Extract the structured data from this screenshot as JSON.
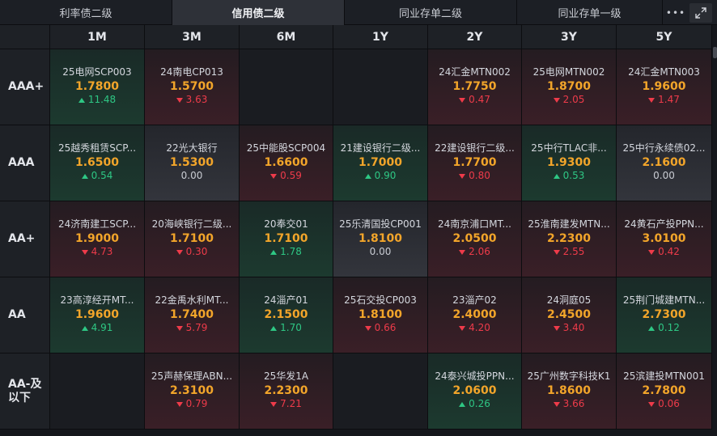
{
  "tabs": [
    {
      "label": "利率债二级",
      "active": false
    },
    {
      "label": "信用债二级",
      "active": true
    },
    {
      "label": "同业存单二级",
      "active": false
    },
    {
      "label": "同业存单一级",
      "active": false
    }
  ],
  "toolbar": {
    "more_label": "•••"
  },
  "columns": [
    "1M",
    "3M",
    "6M",
    "1Y",
    "2Y",
    "3Y",
    "5Y"
  ],
  "rows": [
    {
      "label": "AAA+",
      "cells": [
        {
          "name": "25电网SCP003",
          "price": "1.7800",
          "change": "11.48",
          "dir": "up"
        },
        {
          "name": "24南电CP013",
          "price": "1.5700",
          "change": "3.63",
          "dir": "down"
        },
        null,
        null,
        {
          "name": "24汇金MTN002",
          "price": "1.7750",
          "change": "0.47",
          "dir": "down"
        },
        {
          "name": "25电网MTN002",
          "price": "1.8700",
          "change": "2.05",
          "dir": "down"
        },
        {
          "name": "24汇金MTN003",
          "price": "1.9600",
          "change": "1.47",
          "dir": "down"
        }
      ]
    },
    {
      "label": "AAA",
      "cells": [
        {
          "name": "25越秀租赁SCP...",
          "price": "1.6500",
          "change": "0.54",
          "dir": "up"
        },
        {
          "name": "22光大银行",
          "price": "1.5300",
          "change": "0.00",
          "dir": "flat"
        },
        {
          "name": "25中能股SCP004",
          "price": "1.6600",
          "change": "0.59",
          "dir": "down"
        },
        {
          "name": "21建设银行二级...",
          "price": "1.7000",
          "change": "0.90",
          "dir": "up"
        },
        {
          "name": "22建设银行二级...",
          "price": "1.7700",
          "change": "0.80",
          "dir": "down"
        },
        {
          "name": "25中行TLAC非...",
          "price": "1.9300",
          "change": "0.53",
          "dir": "up"
        },
        {
          "name": "25中行永续债02...",
          "price": "2.1600",
          "change": "0.00",
          "dir": "flat"
        }
      ]
    },
    {
      "label": "AA+",
      "cells": [
        {
          "name": "24济南建工SCP...",
          "price": "1.9000",
          "change": "4.73",
          "dir": "down"
        },
        {
          "name": "20海峡银行二级...",
          "price": "1.7100",
          "change": "0.30",
          "dir": "down"
        },
        {
          "name": "20奉交01",
          "price": "1.7100",
          "change": "1.78",
          "dir": "up"
        },
        {
          "name": "25乐清国投CP001",
          "price": "1.8100",
          "change": "0.00",
          "dir": "flat"
        },
        {
          "name": "24南京浦口MT...",
          "price": "2.0500",
          "change": "2.06",
          "dir": "down"
        },
        {
          "name": "25淮南建发MTN...",
          "price": "2.2300",
          "change": "2.55",
          "dir": "down"
        },
        {
          "name": "24黄石产投PPN...",
          "price": "3.0100",
          "change": "0.42",
          "dir": "down"
        }
      ]
    },
    {
      "label": "AA",
      "cells": [
        {
          "name": "23高淳经开MT...",
          "price": "1.9600",
          "change": "4.91",
          "dir": "up"
        },
        {
          "name": "22金禹水利MT...",
          "price": "1.7400",
          "change": "5.79",
          "dir": "down"
        },
        {
          "name": "24淄产01",
          "price": "2.1500",
          "change": "1.70",
          "dir": "up"
        },
        {
          "name": "25石交投CP003",
          "price": "1.8100",
          "change": "0.66",
          "dir": "down"
        },
        {
          "name": "23淄产02",
          "price": "2.4000",
          "change": "4.20",
          "dir": "down"
        },
        {
          "name": "24洞庭05",
          "price": "2.4500",
          "change": "3.40",
          "dir": "down"
        },
        {
          "name": "25荆门城建MTN...",
          "price": "2.7300",
          "change": "0.12",
          "dir": "up"
        }
      ]
    },
    {
      "label": "AA-及以下",
      "label_lines": [
        "AA-及",
        "以下"
      ],
      "cells": [
        null,
        {
          "name": "25声赫保理ABN...",
          "price": "2.3100",
          "change": "0.79",
          "dir": "down"
        },
        {
          "name": "25华发1A",
          "price": "2.2300",
          "change": "7.21",
          "dir": "down"
        },
        null,
        {
          "name": "24泰兴城投PPN...",
          "price": "2.0600",
          "change": "0.26",
          "dir": "up"
        },
        {
          "name": "25广州数字科技K1",
          "price": "1.8600",
          "change": "3.66",
          "dir": "down"
        },
        {
          "name": "25滨建投MTN001",
          "price": "2.7800",
          "change": "0.06",
          "dir": "down"
        }
      ]
    }
  ],
  "colors": {
    "up": "#2ec784",
    "down": "#ee3b4a",
    "price": "#f2a52a"
  },
  "icons": {
    "more": "more-dots-icon",
    "expand": "expand-icon",
    "up": "triangle-up-icon",
    "down": "triangle-down-icon"
  }
}
